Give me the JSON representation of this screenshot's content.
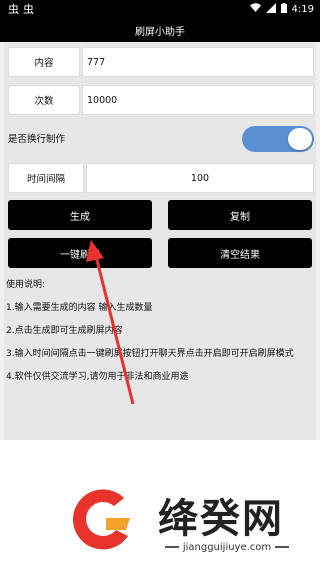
{
  "status_bar": {
    "left_icons": [
      "bug-icon",
      "bug-icon"
    ],
    "time": "4:19"
  },
  "app": {
    "title": "刷屏小助手"
  },
  "form": {
    "content_label": "内容",
    "content_value": "777",
    "count_label": "次数",
    "count_value": "10000",
    "newline_label": "是否换行制作",
    "newline_enabled": true,
    "interval_label": "时间间隔",
    "interval_value": "100"
  },
  "buttons": {
    "generate": "生成",
    "copy": "复制",
    "one_click": "一键刷屏",
    "clear": "清空结果"
  },
  "instructions": {
    "title": "使用说明:",
    "items": [
      "1.输入需要生成的内容 输入生成数量",
      "2.点击生成即可生成刷屏内容",
      "3.输入时间间隔点击一键刷屏按钮打开聊天界点击开启即可开启刷屏模式",
      "4.软件仅供交流学习,请勿用于非法和商业用途"
    ]
  },
  "watermark": {
    "brand_name": "绛癸网",
    "brand_url": "jiangguijiuye.com"
  },
  "colors": {
    "toggle_on": "#5a8fd4",
    "button_bg": "#000000",
    "arrow": "#e8322c",
    "logo_red": "#e8322c",
    "logo_orange": "#f2a12a"
  }
}
